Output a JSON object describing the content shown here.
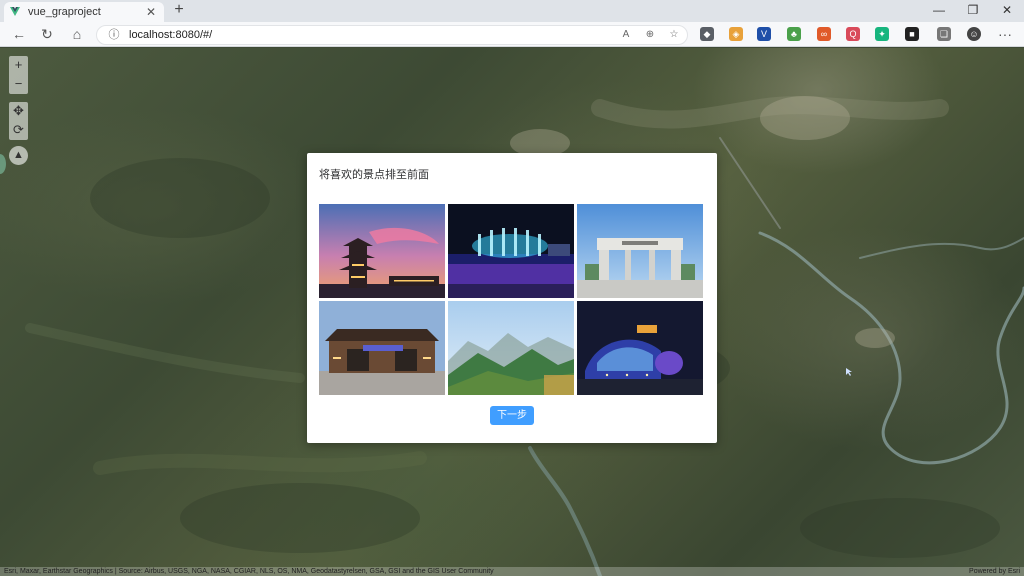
{
  "browser": {
    "tab_title": "vue_graproject",
    "new_tab": "+",
    "url": "localhost:8080/#/",
    "window_controls": [
      "—",
      "❐",
      "✕"
    ],
    "menu": "···"
  },
  "map": {
    "attribution": "Esri, Maxar, Earthstar Geographics | Source: Airbus, USGS, NGA, NASA, CGIAR, NLS, OS, NMA, Geodatastyrelsen, GSA, GSI and the GIS User Community",
    "powered_by": "Powered by Esri"
  },
  "dialog": {
    "title": "将喜欢的景点排至前面",
    "next_button": "下一步",
    "photos": [
      {
        "name": "pavilion-tower-sunset",
        "subject": "Pavilion tower at sunset"
      },
      {
        "name": "fountain-night",
        "subject": "Illuminated fountain at night"
      },
      {
        "name": "university-gate",
        "subject": "University gate"
      },
      {
        "name": "ancient-town-gate",
        "subject": "Traditional gate building"
      },
      {
        "name": "mountain-ridge",
        "subject": "Green mountain ridge"
      },
      {
        "name": "night-stadium",
        "subject": "Arena at night"
      }
    ]
  },
  "colors": {
    "primary": "#409eff",
    "dialog_bg": "#ffffff",
    "browser_bar": "#dfe3e8"
  }
}
